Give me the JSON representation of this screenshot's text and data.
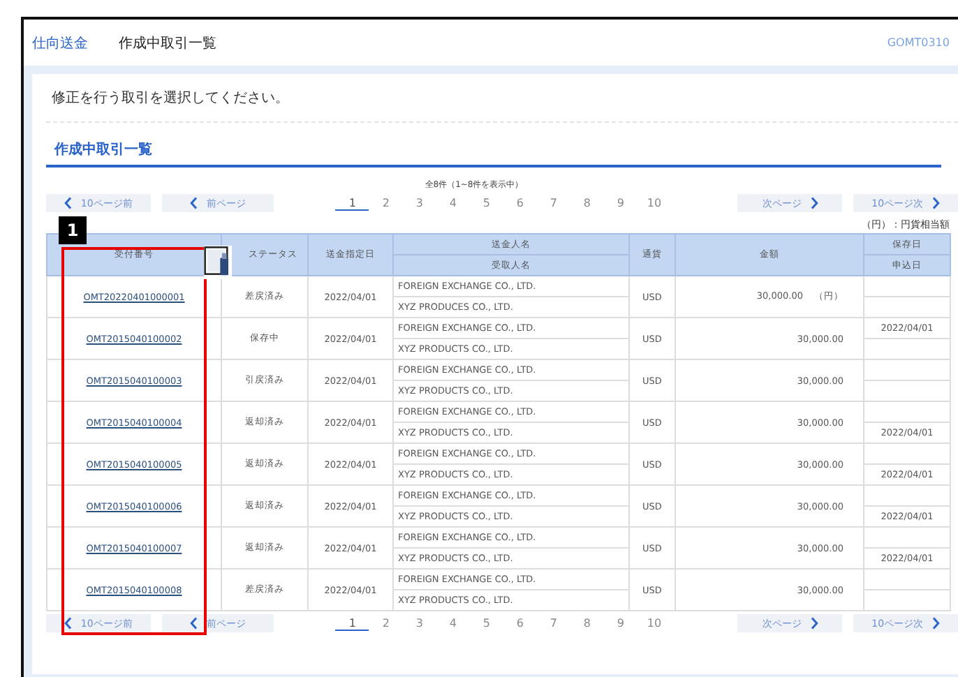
{
  "header": {
    "category": "仕向送金",
    "title": "作成中取引一覧",
    "screen_id": "GOMT0310"
  },
  "instruction": "修正を行う取引を選択してください。",
  "section_title": "作成中取引一覧",
  "result_count": "全8件（1~8件を表示中）",
  "pager_top": {
    "prev10": "10ページ前",
    "prev": "前ページ",
    "next": "次ページ",
    "next10": "10ページ次",
    "pages": [
      {
        "label": "1",
        "selected": true
      },
      {
        "label": "2",
        "selected": false
      },
      {
        "label": "3",
        "selected": false
      },
      {
        "label": "4",
        "selected": false
      },
      {
        "label": "5",
        "selected": false
      },
      {
        "label": "6",
        "selected": false
      },
      {
        "label": "7",
        "selected": false
      },
      {
        "label": "8",
        "selected": false
      },
      {
        "label": "9",
        "selected": false
      },
      {
        "label": "10",
        "selected": false
      }
    ]
  },
  "unit_note": "（円）：円貨相当額",
  "table": {
    "columns": [
      {
        "kind": "single",
        "labels": [
          "受付番号"
        ]
      },
      {
        "kind": "single",
        "labels": [
          "ステータス"
        ]
      },
      {
        "kind": "single",
        "labels": [
          "送金指定日"
        ]
      },
      {
        "kind": "double",
        "labels": [
          "送金人名",
          "受取人名"
        ]
      },
      {
        "kind": "single",
        "labels": [
          "通貨"
        ]
      },
      {
        "kind": "single",
        "labels": [
          "金額"
        ]
      },
      {
        "kind": "double",
        "labels": [
          "保存日",
          "申込日"
        ]
      }
    ],
    "rows": [
      {
        "ref": "OMT20220401000001",
        "status": "差戻済み",
        "date": "2022/04/01",
        "remitter": "FOREIGN EXCHANGE CO., LTD.",
        "beneficiary": "XYZ PRODUCES CO., LTD.",
        "currency": "USD",
        "amount": "30,000.00",
        "amount_unit": "（円）",
        "saved": "",
        "applied": ""
      },
      {
        "ref": "OMT2015040100002",
        "status": "保存中",
        "date": "2022/04/01",
        "remitter": "FOREIGN EXCHANGE CO., LTD.",
        "beneficiary": "XYZ PRODUCTS CO., LTD.",
        "currency": "USD",
        "amount": "30,000.00",
        "saved": "2022/04/01",
        "applied": ""
      },
      {
        "ref": "OMT2015040100003",
        "status": "引戻済み",
        "date": "2022/04/01",
        "remitter": "FOREIGN EXCHANGE CO., LTD.",
        "beneficiary": "XYZ PRODUCTS CO., LTD.",
        "currency": "USD",
        "amount": "30,000.00",
        "saved": "",
        "applied": ""
      },
      {
        "ref": "OMT2015040100004",
        "status": "返却済み",
        "date": "2022/04/01",
        "remitter": "FOREIGN EXCHANGE CO., LTD.",
        "beneficiary": "XYZ PRODUCTS CO., LTD.",
        "currency": "USD",
        "amount": "30,000.00",
        "saved": "",
        "applied": "2022/04/01"
      },
      {
        "ref": "OMT2015040100005",
        "status": "返却済み",
        "date": "2022/04/01",
        "remitter": "FOREIGN EXCHANGE CO., LTD.",
        "beneficiary": "XYZ PRODUCTS CO., LTD.",
        "currency": "USD",
        "amount": "30,000.00",
        "saved": "",
        "applied": "2022/04/01"
      },
      {
        "ref": "OMT2015040100006",
        "status": "返却済み",
        "date": "2022/04/01",
        "remitter": "FOREIGN EXCHANGE CO., LTD.",
        "beneficiary": "XYZ PRODUCTS CO., LTD.",
        "currency": "USD",
        "amount": "30,000.00",
        "saved": "",
        "applied": "2022/04/01"
      },
      {
        "ref": "OMT2015040100007",
        "status": "返却済み",
        "date": "2022/04/01",
        "remitter": "FOREIGN EXCHANGE CO., LTD.",
        "beneficiary": "XYZ PRODUCTS CO., LTD.",
        "currency": "USD",
        "amount": "30,000.00",
        "saved": "",
        "applied": "2022/04/01"
      },
      {
        "ref": "OMT2015040100008",
        "status": "差戻済み",
        "date": "2022/04/01",
        "remitter": "FOREIGN EXCHANGE CO., LTD.",
        "beneficiary": "XYZ PRODUCTS CO., LTD.",
        "currency": "USD",
        "amount": "30,000.00",
        "saved": "",
        "applied": ""
      }
    ]
  },
  "pager_bottom": {
    "prev10": "10ページ前",
    "prev": "前ページ",
    "next": "次ページ",
    "next10": "10ページ次",
    "pages": [
      {
        "label": "1",
        "selected": true
      },
      {
        "label": "2",
        "selected": false
      },
      {
        "label": "3",
        "selected": false
      },
      {
        "label": "4",
        "selected": false
      },
      {
        "label": "5",
        "selected": false
      },
      {
        "label": "6",
        "selected": false
      },
      {
        "label": "7",
        "selected": false
      },
      {
        "label": "8",
        "selected": false
      },
      {
        "label": "9",
        "selected": false
      },
      {
        "label": "10",
        "selected": false
      }
    ]
  },
  "annotation": {
    "badge": "1"
  }
}
